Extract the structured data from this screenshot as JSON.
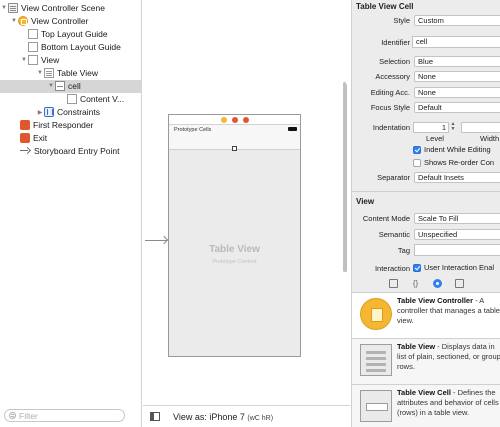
{
  "outline": {
    "items": [
      {
        "label": "View Controller Scene",
        "icon": "scene-icon",
        "disclosure": "▼"
      },
      {
        "label": "View Controller",
        "icon": "view-controller-icon",
        "disclosure": "▼"
      },
      {
        "label": "Top Layout Guide",
        "icon": "layout-guide-icon",
        "disclosure": ""
      },
      {
        "label": "Bottom Layout Guide",
        "icon": "layout-guide-icon",
        "disclosure": ""
      },
      {
        "label": "View",
        "icon": "view-icon",
        "disclosure": "▼"
      },
      {
        "label": "Table View",
        "icon": "table-view-icon",
        "disclosure": "▼"
      },
      {
        "label": "cell",
        "icon": "table-cell-icon",
        "disclosure": "▼"
      },
      {
        "label": "Content V...",
        "icon": "content-view-icon",
        "disclosure": ""
      },
      {
        "label": "Constraints",
        "icon": "constraints-icon",
        "disclosure": "▶"
      },
      {
        "label": "First Responder",
        "icon": "first-responder-icon",
        "disclosure": ""
      },
      {
        "label": "Exit",
        "icon": "exit-icon",
        "disclosure": ""
      },
      {
        "label": "Storyboard Entry Point",
        "icon": "arrow-icon",
        "disclosure": ""
      }
    ],
    "filter_placeholder": "Filter"
  },
  "canvas": {
    "prototype_cells_label": "Prototype Cells",
    "table_view_title": "Table View",
    "table_view_subtitle": "Prototype Content"
  },
  "bottom_bar": {
    "view_as": "View as: iPhone 7",
    "size_class": "(wC hR)"
  },
  "inspector": {
    "cell_section_title": "Table View Cell",
    "style": {
      "label": "Style",
      "value": "Custom"
    },
    "identifier": {
      "label": "Identifier",
      "value": "cell"
    },
    "selection": {
      "label": "Selection",
      "value": "Blue"
    },
    "accessory": {
      "label": "Accessory",
      "value": "None"
    },
    "editing_acc": {
      "label": "Editing Acc.",
      "value": "None"
    },
    "focus_style": {
      "label": "Focus Style",
      "value": "Default"
    },
    "indentation": {
      "label": "Indentation",
      "value": "1",
      "level_label": "Level",
      "width_label": "Width"
    },
    "indent_while_editing": {
      "label": "Indent While Editing",
      "checked": true
    },
    "shows_reorder": {
      "label": "Shows Re-order Con",
      "checked": false
    },
    "separator": {
      "label": "Separator",
      "value": "Default Insets"
    },
    "view_section_title": "View",
    "content_mode": {
      "label": "Content Mode",
      "value": "Scale To Fill"
    },
    "semantic": {
      "label": "Semantic",
      "value": "Unspecified"
    },
    "tag": {
      "label": "Tag",
      "value": ""
    },
    "interaction": {
      "label": "Interaction",
      "value": "User Interaction Enal",
      "checked": true
    }
  },
  "library": {
    "tabs": [
      "file-template-icon",
      "code-snippet-icon",
      "object-library-icon",
      "media-library-icon"
    ],
    "selected_tab": "object-library-icon",
    "items": [
      {
        "title": "Table View Controller",
        "description": [
          "- A",
          "controller that manages a table",
          "view."
        ]
      },
      {
        "title": "Table View",
        "description": [
          "- Displays data in",
          "list of plain, sectioned, or group",
          "rows."
        ]
      },
      {
        "title": "Table View Cell",
        "description": [
          "- Defines the",
          "attributes and behavior of cells",
          "(rows) in a table view."
        ]
      }
    ]
  },
  "colors": {
    "accent_blue": "#2f7ff5",
    "view_controller_yellow": "#f5b731",
    "first_responder_orange": "#e0572f",
    "selection_gray": "#d6d6d6"
  }
}
